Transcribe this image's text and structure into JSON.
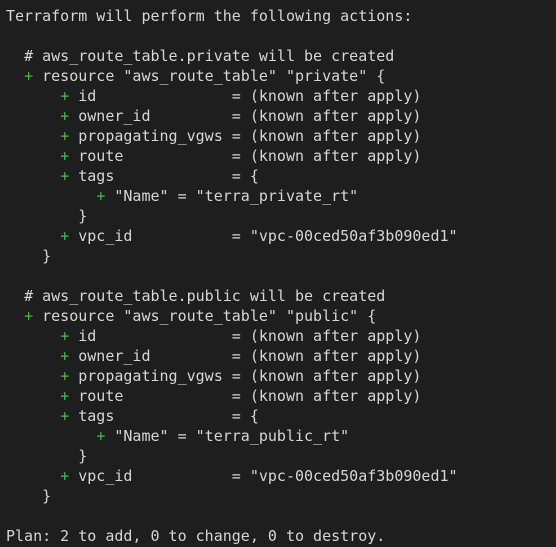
{
  "terminal": {
    "header": "Terraform will perform the following actions:",
    "plus_symbol": "+",
    "resources": [
      {
        "comment": "# aws_route_table.private will be created",
        "resource_decl": "resource \"aws_route_table\" \"private\" {",
        "attrs": {
          "id": "id               = (known after apply)",
          "owner_id": "owner_id         = (known after apply)",
          "propagating_vgws": "propagating_vgws = (known after apply)",
          "route": "route            = (known after apply)",
          "tags": "tags             = {",
          "tag_name": "\"Name\" = \"terra_private_rt\"",
          "tags_close": "}",
          "vpc_id": "vpc_id           = \"vpc-00ced50af3b090ed1\""
        },
        "close": "}"
      },
      {
        "comment": "# aws_route_table.public will be created",
        "resource_decl": "resource \"aws_route_table\" \"public\" {",
        "attrs": {
          "id": "id               = (known after apply)",
          "owner_id": "owner_id         = (known after apply)",
          "propagating_vgws": "propagating_vgws = (known after apply)",
          "route": "route            = (known after apply)",
          "tags": "tags             = {",
          "tag_name": "\"Name\" = \"terra_public_rt\"",
          "tags_close": "}",
          "vpc_id": "vpc_id           = \"vpc-00ced50af3b090ed1\""
        },
        "close": "}"
      }
    ],
    "plan": "Plan: 2 to add, 0 to change, 0 to destroy."
  }
}
